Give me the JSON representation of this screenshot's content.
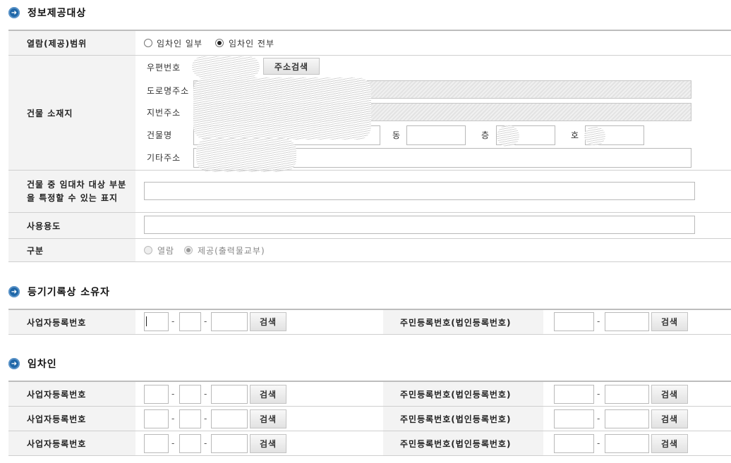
{
  "sections": {
    "info_target": "정보제공대상",
    "owner": "등기기록상 소유자",
    "tenant": "임차인"
  },
  "info": {
    "scope_label": "열람(제공)범위",
    "scope_options": [
      "임차인 일부",
      "임차인 전부"
    ],
    "scope_selected": "임차인 전부",
    "building_label": "건물 소재지",
    "postal_label": "우편번호",
    "address_search_button": "주소검색",
    "road_address_label": "도로명주소",
    "lot_address_label": "지번주소",
    "building_name_label": "건물명",
    "dong_label": "동",
    "floor_label": "층",
    "ho_label": "호",
    "other_address_label": "기타주소",
    "lease_part_label": "건물 중 임대차 대상 부분을 특정할 수 있는 표지",
    "usage_label": "사용용도",
    "type_label": "구분",
    "type_options": [
      "열람",
      "제공(출력물교부)"
    ],
    "type_selected": "제공(출력물교부)"
  },
  "id_rows": {
    "business_label": "사업자등록번호",
    "resident_label": "주민등록번호(법인등록번호)",
    "search_button": "검색",
    "separator": "-"
  },
  "colors": {
    "accent": "#1f67a8",
    "header_bg": "#f3f3f3",
    "border": "#cfcfcf"
  }
}
